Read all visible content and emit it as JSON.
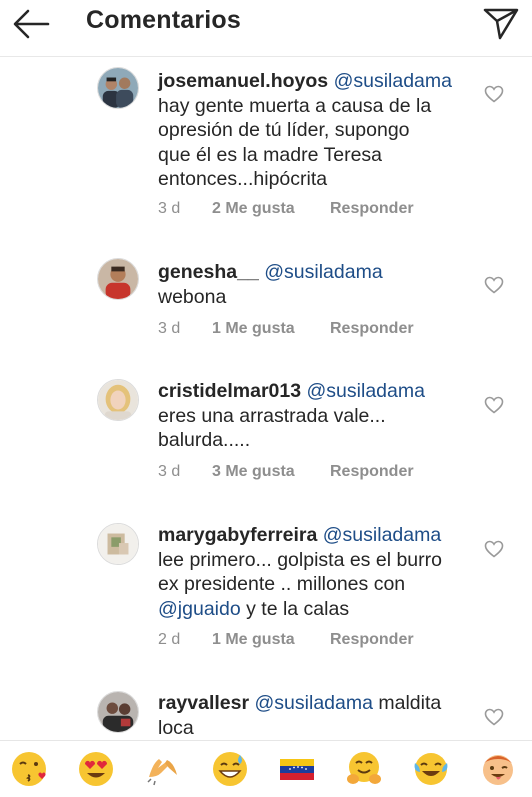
{
  "header": {
    "title": "Comentarios",
    "back_icon": "arrow-left-icon",
    "share_icon": "paper-plane-icon"
  },
  "comments": [
    {
      "username": "josemanuel.hoyos",
      "mention": "@susiladama",
      "text_lines": [
        "hay gente muerta a causa de la",
        "opresión de tú líder, supongo",
        "que él es la madre Teresa",
        "entonces...hipócrita"
      ],
      "time": "3 d",
      "likes": "2 Me gusta",
      "reply": "Responder"
    },
    {
      "username": "genesha__",
      "mention": "@susiladama",
      "text_lines": [
        "webona"
      ],
      "time": "3 d",
      "likes": "1 Me gusta",
      "reply": "Responder"
    },
    {
      "username": "cristidelmar013",
      "mention": "@susiladama",
      "text_lines": [
        "eres una arrastrada vale...",
        "balurda....."
      ],
      "time": "3 d",
      "likes": "3 Me gusta",
      "reply": "Responder"
    },
    {
      "username": "marygabyferreira",
      "mention": "@susiladama",
      "text_lines": [
        "lee primero... golpista es el burro",
        "ex presidente .. millones con"
      ],
      "mention2": "@jguaido",
      "tail": " y te la calas",
      "time": "2 d",
      "likes": "1 Me gusta",
      "reply": "Responder"
    },
    {
      "username": "rayvallesr",
      "mention": "@susiladama",
      "first_tail": " maldita",
      "text_lines": [
        "loca"
      ]
    }
  ],
  "emoji_bar": {
    "items": [
      "kissing-heart-emoji",
      "heart-eyes-emoji",
      "raised-hands-emoji",
      "sweat-smile-emoji",
      "venezuela-flag-emoji",
      "hugging-emoji",
      "joy-emoji",
      "tongue-wink-emoji"
    ]
  },
  "colors": {
    "mention": "#1e4d87",
    "meta": "#8e8e8e",
    "text": "#262626"
  }
}
